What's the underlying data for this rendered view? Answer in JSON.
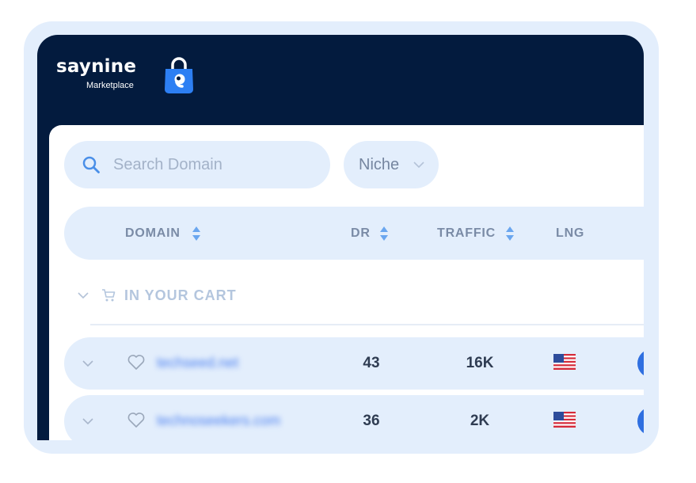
{
  "brand": {
    "name": "saynine",
    "subtitle": "Marketplace",
    "bag_icon": "shopping-bag-icon"
  },
  "search": {
    "placeholder": "Search Domain",
    "value": "",
    "icon": "search-icon"
  },
  "filters": {
    "niche_label": "Niche"
  },
  "table": {
    "columns": [
      {
        "label": "DOMAIN",
        "sortable": true
      },
      {
        "label": "DR",
        "sortable": true
      },
      {
        "label": "TRAFFIC",
        "sortable": true
      },
      {
        "label": "LNG",
        "sortable": false
      }
    ],
    "cart_section_label": "IN YOUR CART",
    "rows": [
      {
        "domain": "techseed.net",
        "dr": "43",
        "traffic": "16K",
        "language": "us-flag"
      },
      {
        "domain": "technoseekers.com",
        "dr": "36",
        "traffic": "2K",
        "language": "us-flag"
      }
    ]
  },
  "colors": {
    "header_bg": "#031b3e",
    "pill_bg": "#e3eefc",
    "accent": "#2f6fe0",
    "sort_arrow": "#6aa6ef"
  }
}
